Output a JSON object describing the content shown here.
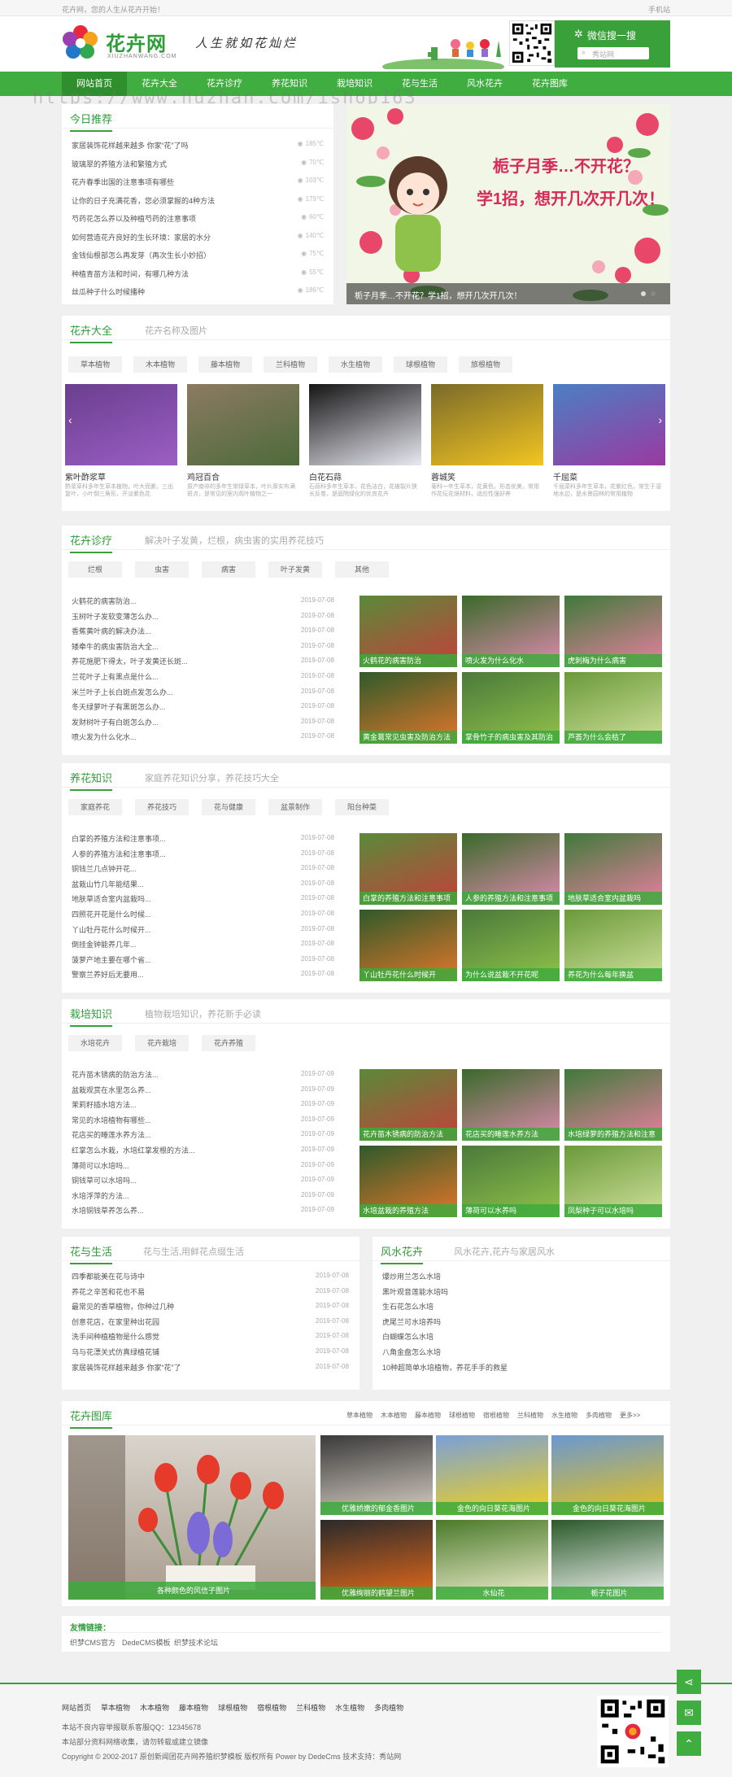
{
  "topbar": {
    "left": "花卉网，您的人生从花卉开始！",
    "right": "手机站"
  },
  "header": {
    "logo_name": "花卉网",
    "logo_en": "XIUZHANWANG.COM",
    "slogan": "人生就如花灿烂",
    "wx_title": "微信搜一搜",
    "search_placeholder": "秀站网"
  },
  "nav": [
    "网站首页",
    "花卉大全",
    "花卉诊疗",
    "养花知识",
    "栽培知识",
    "花与生活",
    "风水花卉",
    "花卉图库"
  ],
  "watermark": "https://www.huzhan.com/ishop163",
  "today": {
    "title": "今日推荐",
    "items": [
      {
        "t": "家居装饰花样越来越多 你家“花”了吗",
        "v": "185℃"
      },
      {
        "t": "玻璃翠的养殖方法和繁殖方式",
        "v": "70℃"
      },
      {
        "t": "花卉春季出国的注意事项有哪些",
        "v": "103℃"
      },
      {
        "t": "让你的日子充满花香，您必须掌握的4种方法",
        "v": "179℃"
      },
      {
        "t": "芍药花怎么养以及种植芍药的注意事项",
        "v": "60℃"
      },
      {
        "t": "如何营造花卉良好的生长环境：家居的水分",
        "v": "140℃"
      },
      {
        "t": "金钱仙根部怎么再发芽（再次生长小妙招）",
        "v": "75℃"
      },
      {
        "t": "种植青苗方法和时间，有哪几种方法",
        "v": "55℃"
      },
      {
        "t": "丝瓜种子什么时候播种",
        "v": "186℃"
      }
    ]
  },
  "banner": {
    "headline1": "栀子月季…不开花？",
    "headline2": "学1招，想开几次开几次！",
    "caption": "栀子月季…不开花？学1招，想开几次开几次！"
  },
  "daquan": {
    "title": "花卉大全",
    "sub": "花卉名称及图片",
    "tags": [
      "草本植物",
      "木本植物",
      "藤本植物",
      "兰科植物",
      "水生植物",
      "球根植物",
      "旅根植物"
    ],
    "items": [
      {
        "name": "紫叶酢浆草",
        "desc": "酢浆草科多年生草本植物，叶大而紫，三出复叶，小叶倒三角形，开淡紫色花"
      },
      {
        "name": "鸡冠百合",
        "desc": "原产南非的多年生常绿草本，叶片厚实布满斑点，是常见的室内观叶植物之一"
      },
      {
        "name": "白花石蒜",
        "desc": "石蒜科多年生草本，花色洁白，花被裂片狭长反卷，是庭院绿化的优良花卉"
      },
      {
        "name": "蓉城笑",
        "desc": "菊科一年生草本，花黄色，形态优美，常用作花坛花境材料，适应性强好养"
      },
      {
        "name": "千屈菜",
        "desc": "千屈菜科多年生草本，花紫红色，常生于湿地水边，是水景园林的常用植物"
      }
    ]
  },
  "zhenliao": {
    "title": "花卉诊疗",
    "sub": "解决叶子发黄，烂根，病虫害的实用养花技巧",
    "tags": [
      "烂根",
      "虫害",
      "病害",
      "叶子发黄",
      "其他"
    ],
    "list": [
      {
        "t": "火鹤花的病害防治...",
        "d": "2019-07-08"
      },
      {
        "t": "玉树叶子发软变薄怎么办...",
        "d": "2019-07-08"
      },
      {
        "t": "香蕉黄叶病的解决办法...",
        "d": "2019-07-08"
      },
      {
        "t": "矮牵牛的病虫害防治大全...",
        "d": "2019-07-08"
      },
      {
        "t": "养花施肥下得太，叶子发黄还长斑...",
        "d": "2019-07-08"
      },
      {
        "t": "兰花叶子上有黑点是什么...",
        "d": "2019-07-08"
      },
      {
        "t": "米兰叶子上长白斑点发怎么办...",
        "d": "2019-07-08"
      },
      {
        "t": "冬天绿萝叶子有黑斑怎么办...",
        "d": "2019-07-08"
      },
      {
        "t": "发财树叶子有白斑怎么办...",
        "d": "2019-07-08"
      },
      {
        "t": "喷火发为什么化水...",
        "d": "2019-07-08"
      }
    ],
    "pics": [
      "火鹤花的病害防治",
      "喷火发为什么化水",
      "虎刺梅为什么病害",
      "黄金葛常见虫害及防治方法",
      "掌骨竹子的病虫害及其防治",
      "芦荟为什么会枯了"
    ]
  },
  "yanghua": {
    "title": "养花知识",
    "sub": "家庭养花知识分享，养花技巧大全",
    "tags": [
      "家庭养花",
      "养花技巧",
      "花与健康",
      "盆景制作",
      "阳台种菜"
    ],
    "list": [
      {
        "t": "白掌的养殖方法和注意事项...",
        "d": "2019-07-08"
      },
      {
        "t": "人参的养殖方法和注意事项...",
        "d": "2019-07-08"
      },
      {
        "t": "铜钱兰几点钟开花...",
        "d": "2019-07-08"
      },
      {
        "t": "盆栽山竹几年能结果...",
        "d": "2019-07-08"
      },
      {
        "t": "地肤草适合室内盆栽吗...",
        "d": "2019-07-08"
      },
      {
        "t": "四照花开花是什么时候...",
        "d": "2019-07-08"
      },
      {
        "t": "丫山牡丹花什么时候开...",
        "d": "2019-07-08"
      },
      {
        "t": "倒挂金钟能养几年...",
        "d": "2019-07-08"
      },
      {
        "t": "菠萝产地主要在哪个省...",
        "d": "2019-07-08"
      },
      {
        "t": "警察兰养好后无要用...",
        "d": "2019-07-08"
      }
    ],
    "pics": [
      "白掌的养殖方法和注意事项",
      "人参的养殖方法和注意事项",
      "地肤草适合室内盆栽吗",
      "丫山牡丹花什么时候开",
      "为什么说盆栽不开花呢",
      "养花为什么每年换盆"
    ]
  },
  "zaipei": {
    "title": "栽培知识",
    "sub": "植物栽培知识，养花新手必读",
    "tags": [
      "水培花卉",
      "花卉栽培",
      "花卉养殖"
    ],
    "list": [
      {
        "t": "花卉苗木锈病的防治方法...",
        "d": "2019-07-09"
      },
      {
        "t": "盆栽观赏在水里怎么养...",
        "d": "2019-07-09"
      },
      {
        "t": "茉莉籽插水培方法...",
        "d": "2019-07-09"
      },
      {
        "t": "常见的水培植物有哪些...",
        "d": "2019-07-09"
      },
      {
        "t": "花店买的睡莲水养方法...",
        "d": "2019-07-09"
      },
      {
        "t": "红掌怎么水栽，水培红掌发根的方法...",
        "d": "2019-07-09"
      },
      {
        "t": "薄荷可以水培吗...",
        "d": "2019-07-09"
      },
      {
        "t": "铜钱草可以水培吗...",
        "d": "2019-07-09"
      },
      {
        "t": "水培浮萍的方法...",
        "d": "2019-07-09"
      },
      {
        "t": "水培铜钱草养怎么养...",
        "d": "2019-07-09"
      }
    ],
    "pics": [
      "花卉苗木锈病的防治方法",
      "花店买的睡莲水养方法",
      "水培绿萝的养殖方法和注意",
      "水培盆栽的养殖方法",
      "薄荷可以水养吗",
      "凤梨种子可以水培吗"
    ]
  },
  "life": {
    "title": "花与生活",
    "sub": "花与生活,用鲜花点缀生活",
    "list": [
      {
        "t": "四季都能美在花与诗中",
        "d": "2019-07-08"
      },
      {
        "t": "养花之辛苦和花也不易",
        "d": "2019-07-08"
      },
      {
        "t": "最常见的香草植物，你种过几种",
        "d": "2019-07-08"
      },
      {
        "t": "创意花店，在家里种出花园",
        "d": "2019-07-08"
      },
      {
        "t": "洗手间种植植物是什么感觉",
        "d": "2019-07-08"
      },
      {
        "t": "乌与花漂关式仿真绿植花铺",
        "d": "2019-07-08"
      },
      {
        "t": "家居装饰花样越来越多 你家“花”了",
        "d": "2019-07-08"
      }
    ]
  },
  "fengshui": {
    "title": "风水花卉",
    "sub": "风水花卉,花卉与家居风水",
    "list": [
      "爆炒用兰怎么水培",
      "黑叶观音莲能水培吗",
      "生石花怎么水培",
      "虎尾兰可水培养吗",
      "白蝴蝶怎么水培",
      "八角金盘怎么水培",
      "10种超简单水培植物，养花手手的救星"
    ]
  },
  "gallery": {
    "title": "花卉图库",
    "cats": [
      "草本植物",
      "木本植物",
      "藤本植物",
      "球根植物",
      "宿根植物",
      "兰科植物",
      "水生植物",
      "多肉植物",
      "更多>>"
    ],
    "big": "各种颜色的风信子图片",
    "pics": [
      "优雅娇嫩的郁金香图片",
      "金色的向日葵花海图片",
      "金色的向日葵花海图片",
      "优雅绚丽的鹤望兰图片",
      "水仙花",
      "栀子花图片"
    ]
  },
  "friends": {
    "title": "友情链接：",
    "links": [
      "织梦CMS官方",
      "DedeCMS模板",
      "织梦技术论坛"
    ]
  },
  "footer": {
    "links": [
      "网站首页",
      "草本植物",
      "木本植物",
      "藤本植物",
      "球根植物",
      "宿根植物",
      "兰科植物",
      "水生植物",
      "多肉植物"
    ],
    "l1": "本站不良内容举报联系客服QQ：12345678",
    "l2": "本站部分资料网络收集，请勿转载或建立镜像",
    "l3": "Copyright © 2002-2017 原创新闻团花卉网养殖织梦模板 版权所有 Power by DedeCms 技术支持：秀站网"
  }
}
